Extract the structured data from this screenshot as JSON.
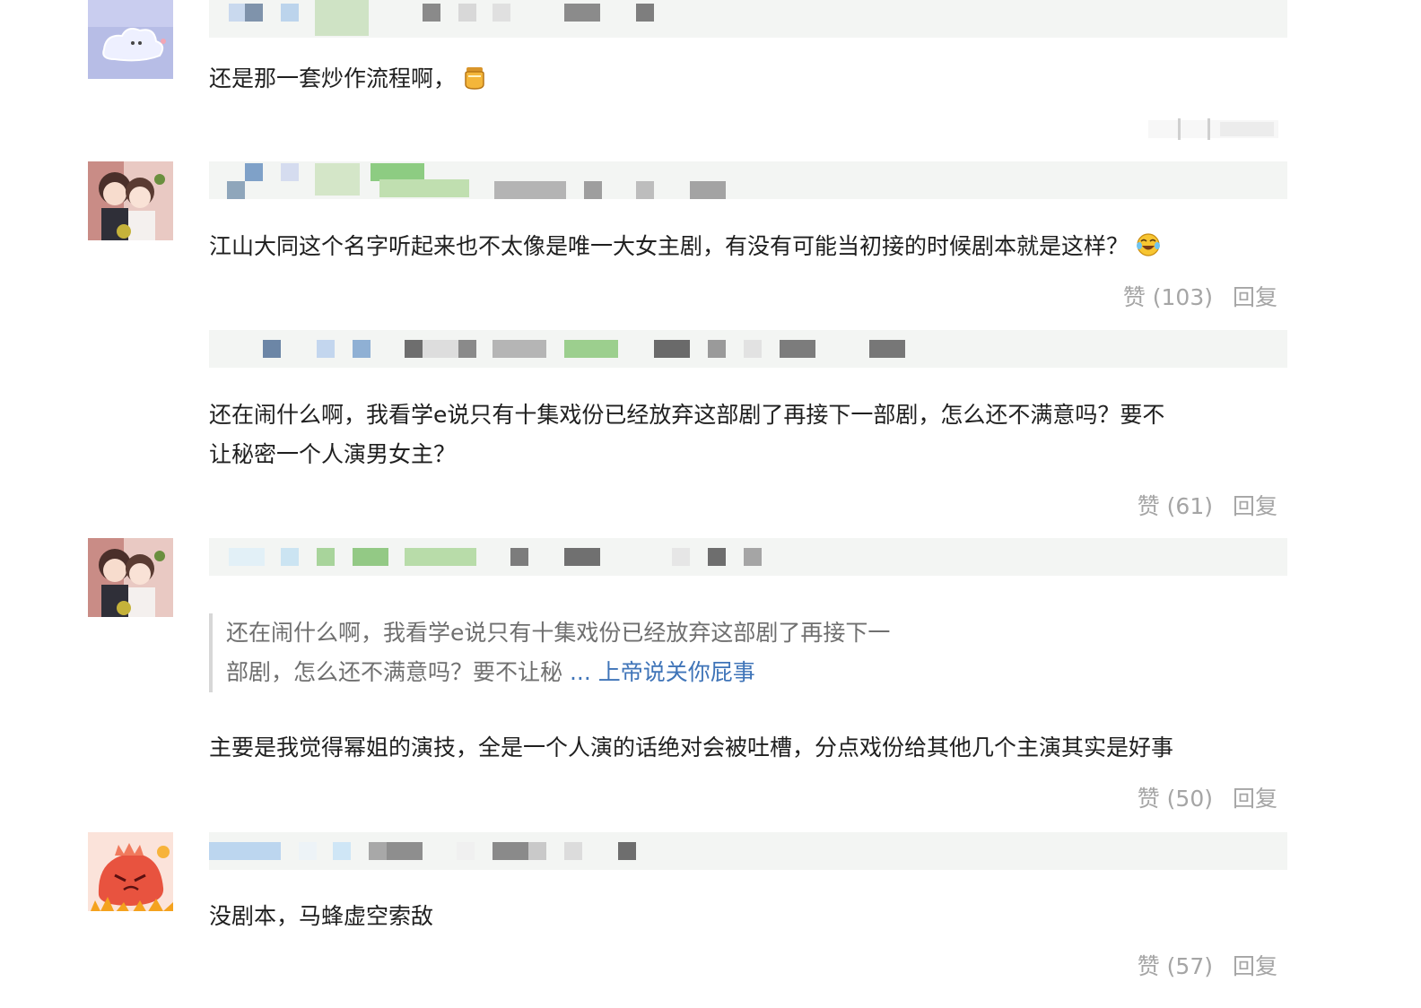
{
  "comments": [
    {
      "avatar": "cloud-doodle-avatar",
      "text": "还是那一套炒作流程啊，",
      "emoji": "honey-jar-icon"
    },
    {
      "avatar": "couple-cartoon-avatar",
      "text": "江山大同这个名字听起来也不太像是唯一大女主剧，有没有可能当初接的时候剧本就是这样？",
      "emoji": "laughing-tears-icon",
      "like_label": "赞 (103)",
      "reply_label": "回复"
    },
    {
      "avatar": null,
      "text_line1": "还在闹什么啊，我看学e说只有十集戏份已经放弃这部剧了再接下一部剧，怎么还不满意吗？要不",
      "text_line2": "让秘密一个人演男女主？",
      "like_label": "赞 (61)",
      "reply_label": "回复"
    },
    {
      "avatar": "couple-cartoon-avatar",
      "quote_line1": "还在闹什么啊，我看学e说只有十集戏份已经放弃这部剧了再接下一",
      "quote_line2": "部剧，怎么还不满意吗？要不让秘",
      "quote_link": "... 上帝说关你屁事",
      "text": "主要是我觉得幂姐的演技，全是一个人演的话绝对会被吐槽，分点戏份给其他几个主演其实是好事",
      "like_label": "赞 (50)",
      "reply_label": "回复"
    },
    {
      "avatar": "red-monster-avatar",
      "text": "没剧本，马蜂虚空索敌",
      "like_label": "赞 (57)",
      "reply_label": "回复"
    }
  ]
}
